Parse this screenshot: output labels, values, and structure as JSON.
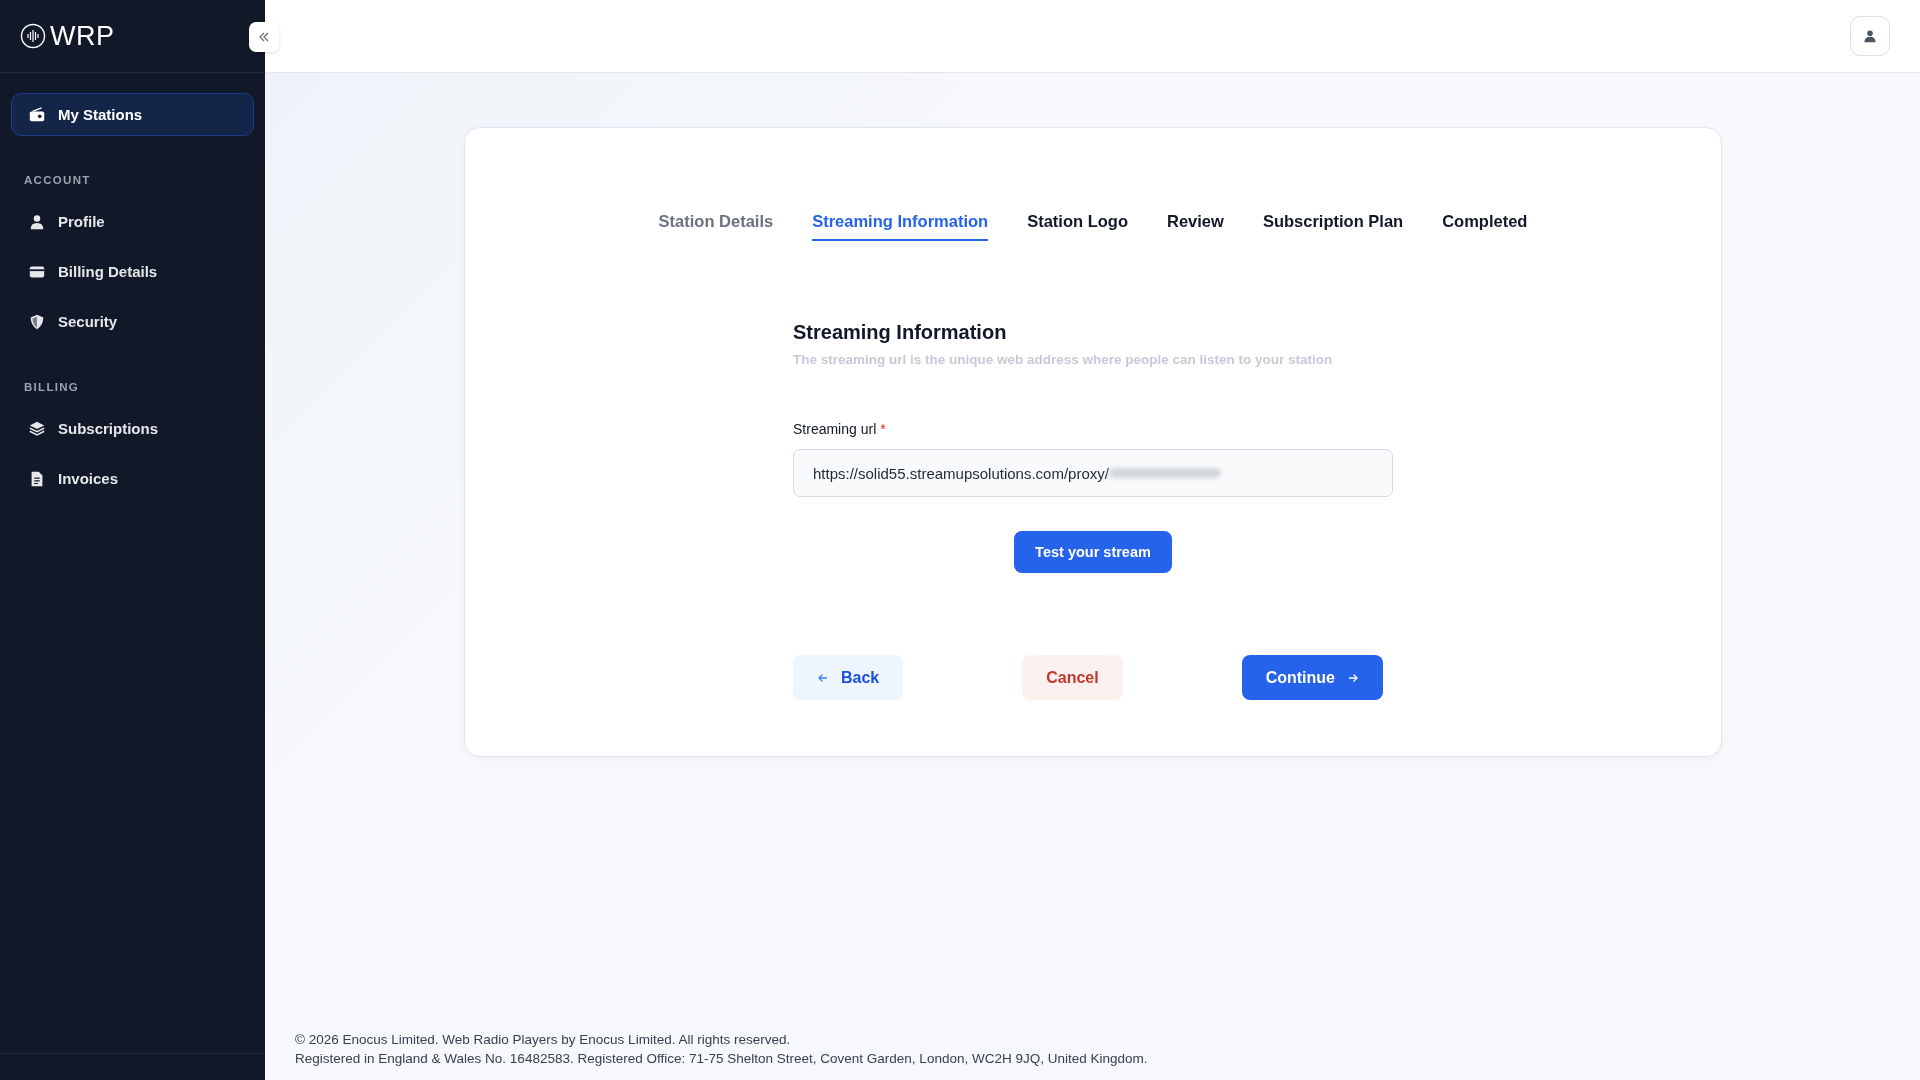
{
  "sidebar": {
    "logo": "WRP",
    "top_items": [
      {
        "label": "My Stations",
        "kind": "radio",
        "selected": true
      }
    ],
    "sections": [
      {
        "title": "ACCOUNT",
        "items": [
          {
            "label": "Profile",
            "kind": "user",
            "selected": false
          },
          {
            "label": "Billing Details",
            "kind": "card",
            "selected": false
          },
          {
            "label": "Security",
            "kind": "shield",
            "selected": false
          }
        ]
      },
      {
        "title": "BILLING",
        "items": [
          {
            "label": "Subscriptions",
            "kind": "layers",
            "selected": false
          },
          {
            "label": "Invoices",
            "kind": "doc",
            "selected": false
          }
        ]
      }
    ]
  },
  "tabs": [
    {
      "label": "Station Details",
      "selected": false,
      "visited": true
    },
    {
      "label": "Streaming Information",
      "selected": true,
      "visited": false
    },
    {
      "label": "Station Logo",
      "selected": false,
      "visited": false
    },
    {
      "label": "Review",
      "selected": false,
      "visited": false
    },
    {
      "label": "Subscription Plan",
      "selected": false,
      "visited": false
    },
    {
      "label": "Completed",
      "selected": false,
      "visited": false
    }
  ],
  "form": {
    "title": "Streaming Information",
    "subtitle": "The streaming url is the unique web address where people can listen to your station",
    "field": {
      "label": "Streaming url",
      "required_mark": "*",
      "value": "https://solid55.streamupsolutions.com/proxy/"
    },
    "test_button": "Test your stream"
  },
  "actions": {
    "back": "Back",
    "cancel": "Cancel",
    "continue": "Continue"
  },
  "footer": [
    "© 2026 Enocus Limited. Web Radio Players by Enocus Limited. All rights reserved.",
    "Registered in England & Wales No. 16482583. Registered Office: 71-75 Shelton Street, Covent Garden, London, WC2H 9JQ, United Kingdom."
  ]
}
